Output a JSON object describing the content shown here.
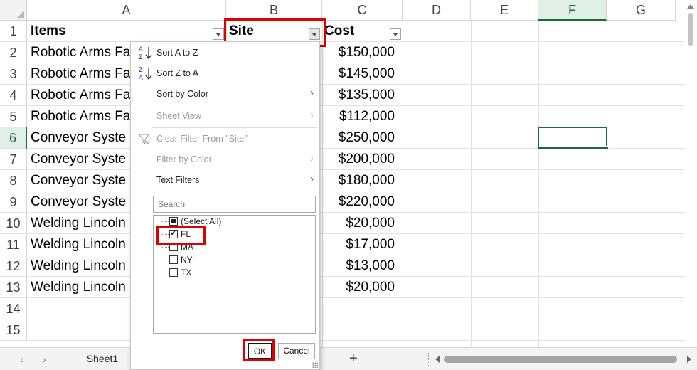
{
  "columns": [
    "A",
    "B",
    "C",
    "D",
    "E",
    "F",
    "G"
  ],
  "selected_column": "F",
  "rows": [
    "1",
    "2",
    "3",
    "4",
    "5",
    "6",
    "7",
    "8",
    "9",
    "10",
    "11",
    "12",
    "13",
    "14",
    "15"
  ],
  "selected_row": "6",
  "table": {
    "headers": [
      "Items",
      "Site",
      "Cost"
    ],
    "items": [
      "Robotic Arms Fa",
      "Robotic Arms Fa",
      "Robotic Arms Fa",
      "Robotic Arms Fa",
      "Conveyor Syste",
      "Conveyor Syste",
      "Conveyor Syste",
      "Conveyor Syste",
      "Welding Lincoln",
      "Welding Lincoln",
      "Welding Lincoln",
      "Welding Lincoln"
    ],
    "costs": [
      "$150,000",
      "$145,000",
      "$135,000",
      "$112,000",
      "$250,000",
      "$200,000",
      "$180,000",
      "$220,000",
      "$20,000",
      "$17,000",
      "$13,000",
      "$20,000"
    ]
  },
  "dropdown": {
    "sort_az": "Sort A to Z",
    "sort_za": "Sort Z to A",
    "sort_by_color": "Sort by Color",
    "sheet_view": "Sheet View",
    "clear_filter": "Clear Filter From \"Site\"",
    "filter_by_color": "Filter by Color",
    "text_filters": "Text Filters",
    "search_placeholder": "Search",
    "options": [
      {
        "label": "(Select All)",
        "state": "mixed"
      },
      {
        "label": "FL",
        "state": "checked"
      },
      {
        "label": "MA",
        "state": "unchecked"
      },
      {
        "label": "NY",
        "state": "unchecked"
      },
      {
        "label": "TX",
        "state": "unchecked"
      }
    ],
    "ok_label": "OK",
    "cancel_label": "Cancel"
  },
  "tabs": {
    "sheet_name": "Sheet1",
    "add_label": "+"
  },
  "colors": {
    "accent_green": "#1d6b3a",
    "highlight_red": "#e00000"
  }
}
